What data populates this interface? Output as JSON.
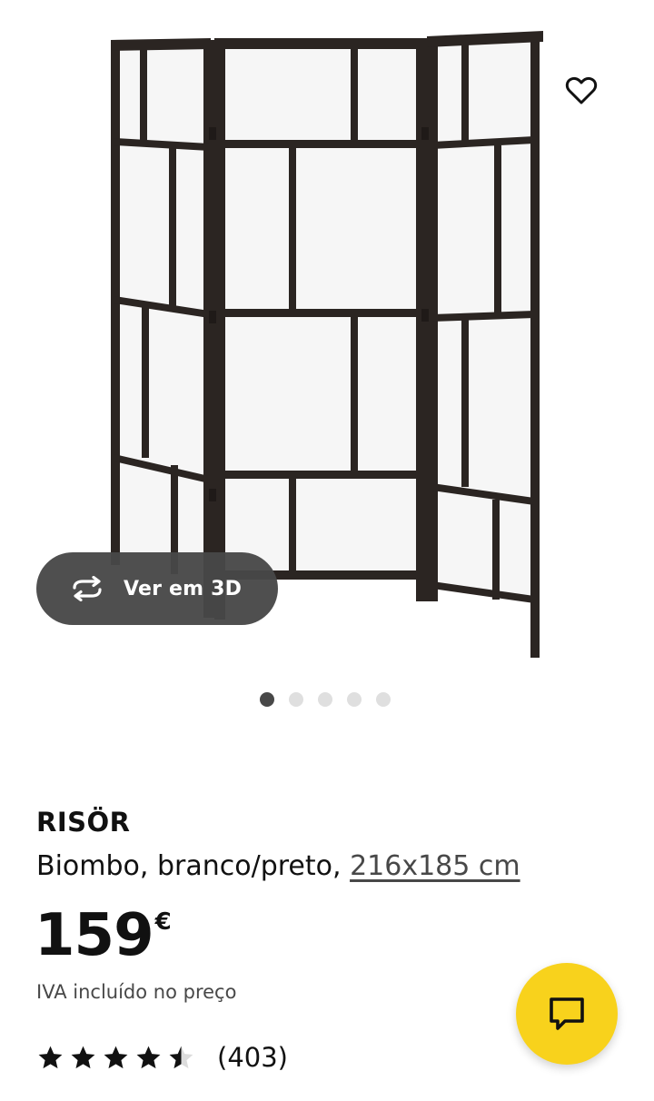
{
  "product": {
    "brand": "RISÖR",
    "description": "Biombo, branco/preto, ",
    "size": "216x185 cm",
    "price_amount": "159",
    "price_currency": "€",
    "vat_note": "IVA incluído no preço"
  },
  "gallery": {
    "view3d_label": "Ver em 3D",
    "image_count": 5,
    "active_image_index": 0
  },
  "rating": {
    "stars_value": 4.5,
    "stars_max": 5,
    "review_count": "(403)"
  },
  "colors": {
    "chat_button_bg": "#F8D21C",
    "dark_pill": "#484848",
    "frame": "#2b2522",
    "panel": "#f6f6f6"
  },
  "icons": {
    "favorite": "heart-outline-icon",
    "view3d": "rotate-3d-icon",
    "chat": "chat-bubble-icon",
    "rating": "star-icon"
  }
}
